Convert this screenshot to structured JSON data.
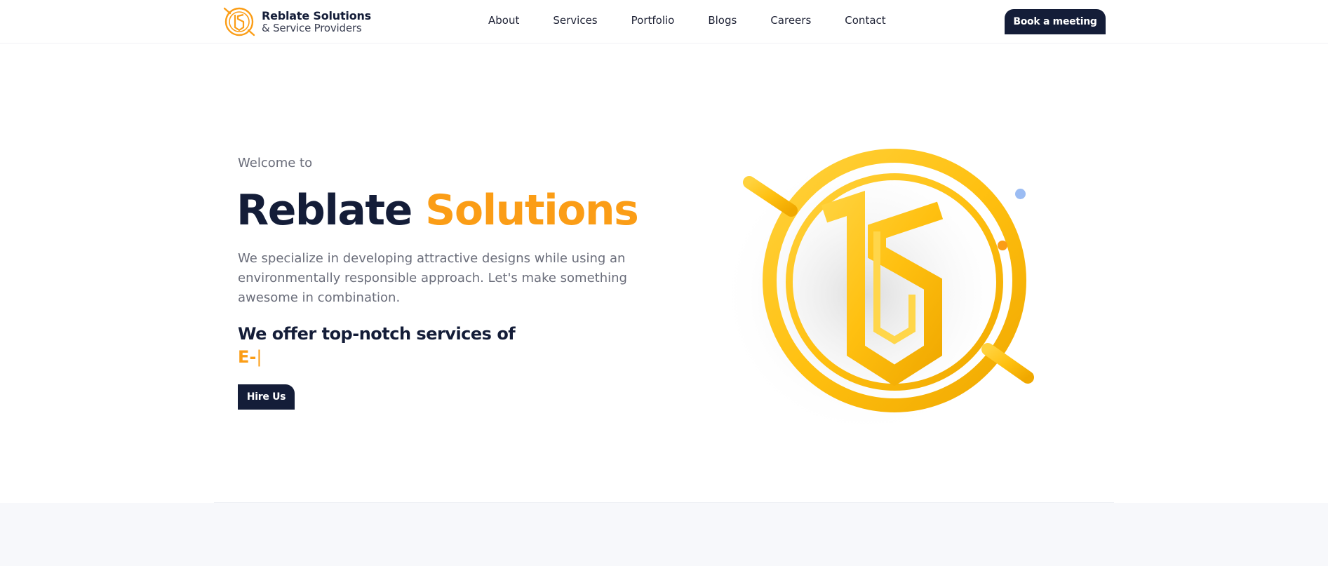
{
  "header": {
    "brand_name": "Reblate Solutions",
    "brand_sub": "& Service Providers",
    "nav": [
      "About",
      "Services",
      "Portfolio",
      "Blogs",
      "Careers",
      "Contact"
    ],
    "cta_label": "Book a meeting"
  },
  "hero": {
    "welcome": "Welcome to",
    "title_dark": "Reblate",
    "title_accent": "Solutions",
    "description": "We specialize in developing attractive designs while using an environmentally responsible approach. Let's make something awesome in combination.",
    "offer_heading": "We offer top-notch services of",
    "typed_text": "E-",
    "typed_cursor": "|",
    "hire_label": "Hire Us"
  },
  "colors": {
    "navy": "#141d38",
    "orange": "#fb9d16",
    "gold": "#ffc21a",
    "muted_text": "#6a6d7a",
    "dot_blue": "#9bbcf3"
  },
  "icons": {
    "brand_logo": "rs-monogram-circle-icon",
    "hero_art": "rs-monogram-3d-emblem"
  }
}
